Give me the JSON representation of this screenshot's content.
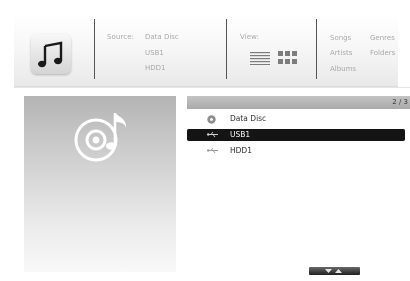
{
  "header": {
    "source_label": "Source:",
    "sources": [
      "Data Disc",
      "USB1",
      "HDD1"
    ],
    "view_label": "View:",
    "views": [
      "list-view-icon",
      "grid-view-icon"
    ],
    "categories": [
      "Songs",
      "Genres",
      "Artists",
      "Folders",
      "Albums"
    ]
  },
  "list": {
    "page_indicator": "2 / 3",
    "items": [
      {
        "label": "Data Disc",
        "icon": "disc-icon",
        "selected": false
      },
      {
        "label": "USB1",
        "icon": "usb-icon",
        "selected": true
      },
      {
        "label": "HDD1",
        "icon": "usb-icon",
        "selected": false
      }
    ]
  },
  "art_icon": "disc-music-icon",
  "app_icon": "music-note-icon",
  "scroll_icon": "scroll-up-down-icon",
  "colors": {
    "selection": "#141414",
    "list_header": "#b0b0b0",
    "label_text": "#a8a8a8"
  }
}
